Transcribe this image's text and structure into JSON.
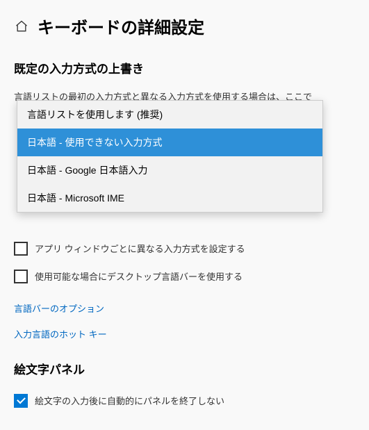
{
  "header": {
    "title": "キーボードの詳細設定"
  },
  "section_override": {
    "heading": "既定の入力方式の上書き",
    "description": "言語リストの最初の入力方式と異なる入力方式を使用する場合は、ここで"
  },
  "dropdown": {
    "items": [
      {
        "label": "言語リストを使用します (推奨)",
        "highlighted": false
      },
      {
        "label": "日本語 - 使用できない入力方式",
        "highlighted": true
      },
      {
        "label": "日本語 - Google 日本語入力",
        "highlighted": false
      },
      {
        "label": "日本語 - Microsoft IME",
        "highlighted": false
      }
    ]
  },
  "checkboxes": {
    "per_app": {
      "label": "アプリ ウィンドウごとに異なる入力方式を設定する",
      "checked": false
    },
    "desktop_langbar": {
      "label": "使用可能な場合にデスクトップ言語バーを使用する",
      "checked": false
    }
  },
  "links": {
    "langbar_options": "言語バーのオプション",
    "input_hotkeys": "入力言語のホット キー"
  },
  "emoji_panel": {
    "heading": "絵文字パネル",
    "auto_close": {
      "label": "絵文字の入力後に自動的にパネルを終了しない",
      "checked": true
    }
  }
}
